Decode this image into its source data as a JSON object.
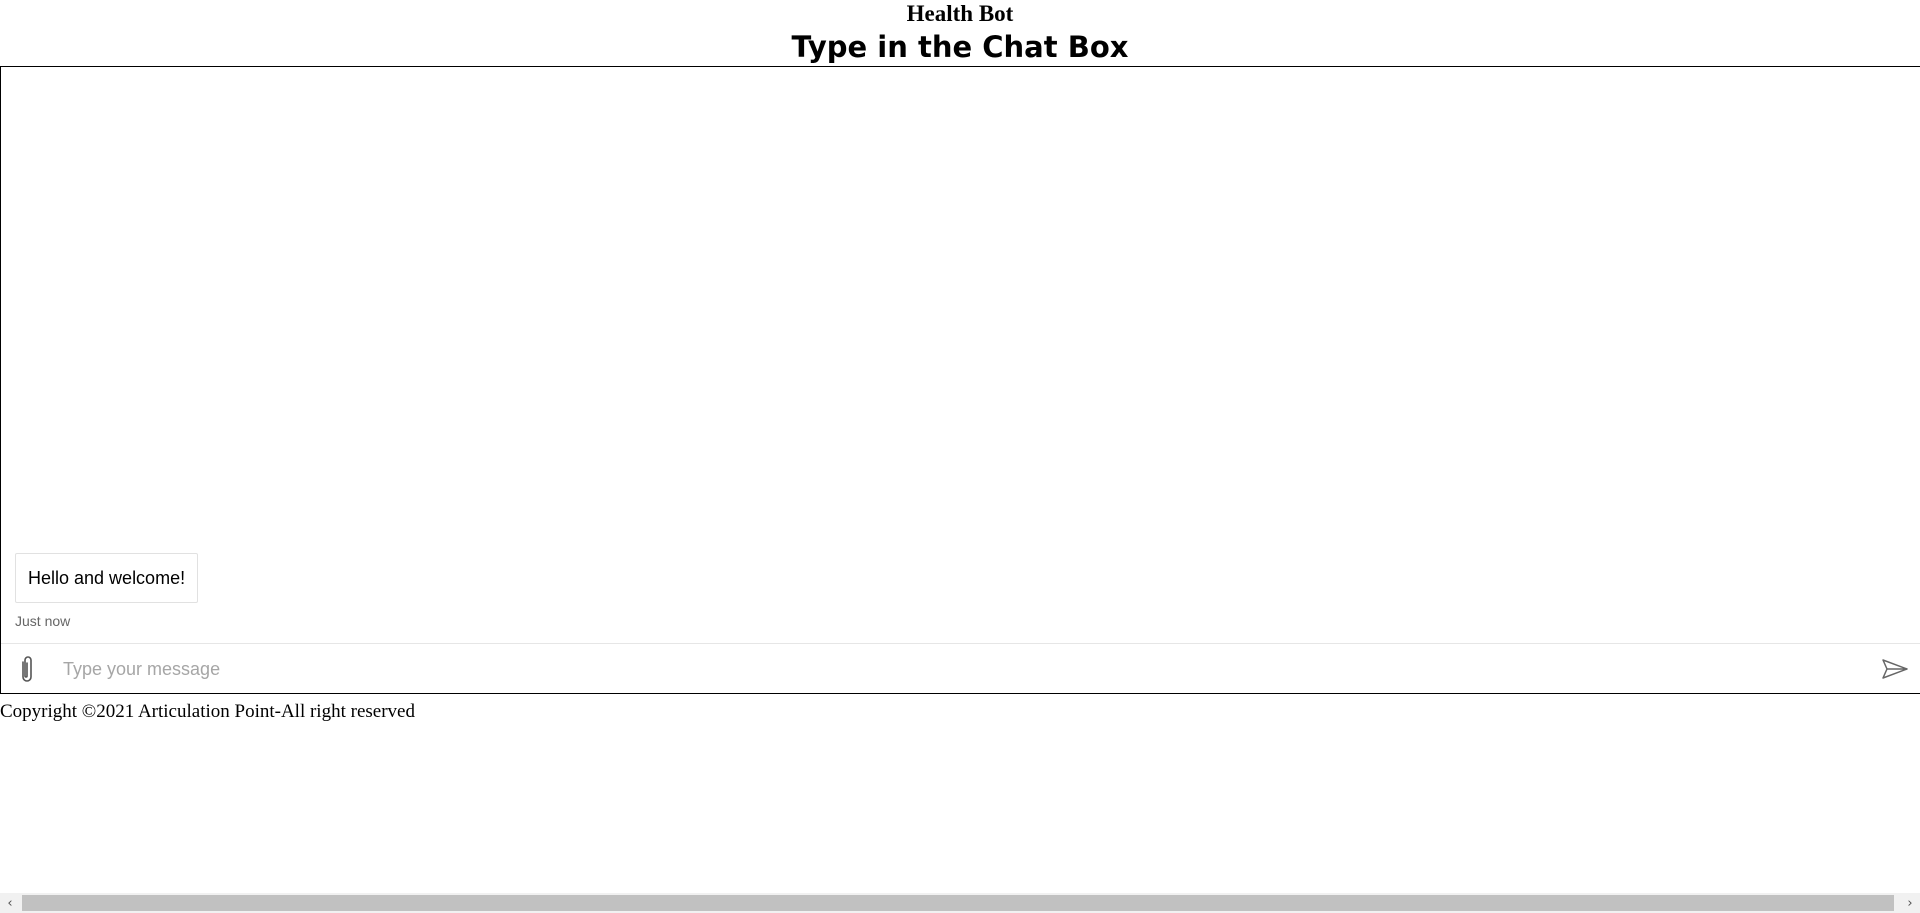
{
  "header": {
    "site_title": "Health Bot",
    "chat_heading": "Type in the Chat Box"
  },
  "chat": {
    "messages": [
      {
        "text": "Hello and welcome!",
        "timestamp": "Just now"
      }
    ],
    "input": {
      "placeholder": "Type your message",
      "value": ""
    },
    "icons": {
      "attach": "paperclip-icon",
      "send": "send-icon"
    }
  },
  "footer": {
    "copyright": "Copyright ©2021 Articulation Point-All right reserved"
  },
  "scrollbar": {
    "left_arrow": "‹",
    "right_arrow": "›"
  }
}
